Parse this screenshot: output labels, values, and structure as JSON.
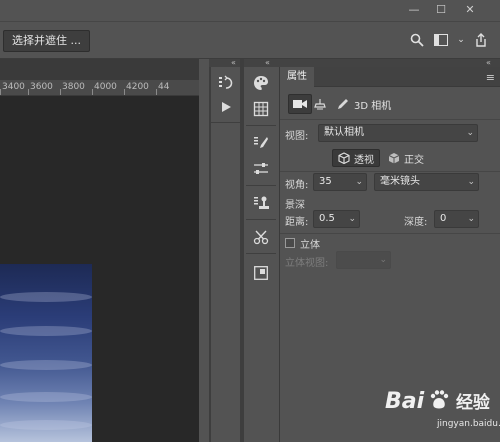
{
  "window": {
    "minimize_glyph": "—",
    "restore_glyph": "☐",
    "close_glyph": "✕"
  },
  "options_bar": {
    "select_mask_button": "选择并遮住 ...",
    "icons": [
      "search-icon",
      "panel-layout-icon",
      "chevron-down-icon",
      "share-icon"
    ]
  },
  "ruler": {
    "ticks": [
      "3400",
      "3600",
      "3800",
      "4000",
      "4200",
      "44"
    ]
  },
  "dock": {
    "collapse_glyph": "«",
    "column1_tools": [
      "history-icon",
      "actions-play-icon"
    ],
    "column2_tools": [
      "paint-palette-icon",
      "grid-icon",
      "brush-settings-icon",
      "brushes-icon",
      "adjustments-icon",
      "clone-source-icon",
      "tools-cut-icon",
      "navigator-icon"
    ]
  },
  "properties": {
    "tab_label": "属性",
    "menu_glyph": "≡",
    "subtab_camera_glyph": "■",
    "subtab_light_glyph": "♨",
    "subtab_pen_glyph": "✎",
    "subtab_3d_label": "3D 相机",
    "view_label": "视图:",
    "view_value": "默认相机",
    "perspective_label": "透视",
    "orthographic_label": "正交",
    "angle_label": "视角:",
    "angle_value": "35",
    "lens_value": "毫米镜头",
    "depth_field_label": "景深",
    "distance_label": "距离:",
    "distance_value": "0.5",
    "depth_label": "深度:",
    "depth_value": "0",
    "stereo_label": "立体",
    "stereo_view_label": "立体视图:",
    "stereo_view_value": ""
  },
  "watermark": {
    "brand": "Bai",
    "brand_cn": "经验",
    "url": "jingyan.baidu.com"
  }
}
